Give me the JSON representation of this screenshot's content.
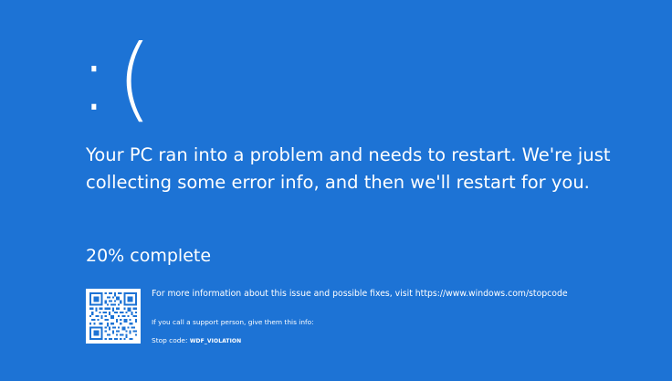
{
  "screen": {
    "background_color": "#1d73d5",
    "text_color": "#ffffff"
  },
  "sad_face": ":(",
  "message": "Your PC ran into a problem and needs to restart. We're just collecting some error info, and then we'll restart for you.",
  "progress": {
    "text": "20% complete",
    "percent": 20
  },
  "qr_code": {
    "icon": "qr-code-icon"
  },
  "info": {
    "more_info": "For more information about this issue and possible fixes, visit https://www.windows.com/stopcode",
    "support_prompt": "If you call a support person, give them this info:",
    "stop_code_label": "Stop code:",
    "stop_code_value": "WDF_VIOLATION"
  }
}
